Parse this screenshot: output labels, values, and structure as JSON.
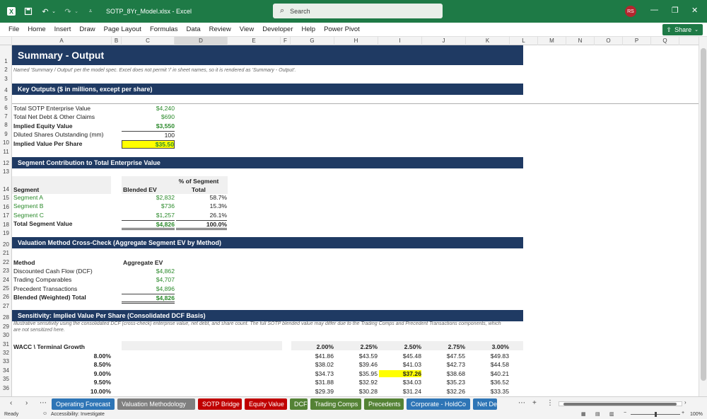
{
  "window": {
    "filename": "SOTP_8Yr_Model.xlsx",
    "app": "Excel",
    "search_placeholder": "Search",
    "user_initials": "RS"
  },
  "menu": [
    "File",
    "Home",
    "Insert",
    "Draw",
    "Page Layout",
    "Formulas",
    "Data",
    "Review",
    "View",
    "Developer",
    "Help",
    "Power Pivot"
  ],
  "share_label": "Share",
  "columns": [
    "A",
    "B",
    "C",
    "D",
    "E",
    "F",
    "G",
    "H",
    "I",
    "J",
    "K",
    "L",
    "M",
    "N",
    "O",
    "P",
    "Q"
  ],
  "rows": [
    "1",
    "2",
    "3",
    "4",
    "5",
    "6",
    "7",
    "8",
    "9",
    "10",
    "11",
    "12",
    "13",
    "14",
    "15",
    "16",
    "17",
    "18",
    "19",
    "20",
    "21",
    "22",
    "23",
    "24",
    "25",
    "26",
    "27",
    "28",
    "29",
    "30",
    "31",
    "32",
    "33",
    "34",
    "35",
    "36"
  ],
  "sheet": {
    "title": "Summary - Output",
    "note_r2": "Named 'Summary / Output' per the model spec. Excel does not permit '/' in sheet names, so it is rendered as 'Summary - Output'.",
    "key_outputs": {
      "header": "Key Outputs ($ in millions, except per share)",
      "rows": [
        {
          "label": "Total SOTP Enterprise Value",
          "value": "$4,240"
        },
        {
          "label": "Total Net Debt & Other Claims",
          "value": "$690"
        },
        {
          "label": "Implied Equity Value",
          "value": "$3,550"
        },
        {
          "label": "Diluted Shares Outstanding (mm)",
          "value": "100"
        },
        {
          "label": "Implied Value Per Share",
          "value": "$35.50"
        }
      ]
    },
    "segments": {
      "header": "Segment Contribution to Total Enterprise Value",
      "col_segment": "Segment",
      "col_ev": "Blended EV",
      "col_pct_line1": "% of Segment",
      "col_pct_line2": "Total",
      "rows": [
        {
          "label": "Segment A",
          "ev": "$2,832",
          "pct": "58.7%"
        },
        {
          "label": "Segment B",
          "ev": "$736",
          "pct": "15.3%"
        },
        {
          "label": "Segment C",
          "ev": "$1,257",
          "pct": "26.1%"
        }
      ],
      "total_label": "Total Segment Value",
      "total_ev": "$4,826",
      "total_pct": "100.0%"
    },
    "crosscheck": {
      "header": "Valuation Method Cross-Check (Aggregate Segment EV by Method)",
      "col_method": "Method",
      "col_ev": "Aggregate EV",
      "rows": [
        {
          "label": "Discounted Cash Flow (DCF)",
          "ev": "$4,862"
        },
        {
          "label": "Trading Comparables",
          "ev": "$4,707"
        },
        {
          "label": "Precedent Transactions",
          "ev": "$4,896"
        }
      ],
      "total_label": "Blended (Weighted) Total",
      "total_ev": "$4,826"
    },
    "sensitivity": {
      "header": "Sensitivity: Implied Value Per Share (Consolidated DCF Basis)",
      "note": "Illustrative sensitivity using the consolidated DCF (cross-check) enterprise value, net debt, and share count. The full SOTP blended value may differ due to the Trading Comps and Precedent Transactions components, which are not sensitized here.",
      "corner_label": "WACC \\ Terminal Growth",
      "growth": [
        "2.00%",
        "2.25%",
        "2.50%",
        "2.75%",
        "3.00%"
      ],
      "rows": [
        {
          "wacc": "8.00%",
          "values": [
            "$41.86",
            "$43.59",
            "$45.48",
            "$47.55",
            "$49.83"
          ]
        },
        {
          "wacc": "8.50%",
          "values": [
            "$38.02",
            "$39.46",
            "$41.03",
            "$42.73",
            "$44.58"
          ]
        },
        {
          "wacc": "9.00%",
          "values": [
            "$34.73",
            "$35.95",
            "$37.26",
            "$38.68",
            "$40.21"
          ]
        },
        {
          "wacc": "9.50%",
          "values": [
            "$31.88",
            "$32.92",
            "$34.03",
            "$35.23",
            "$36.52"
          ]
        },
        {
          "wacc": "10.00%",
          "values": [
            "$29.39",
            "$30.28",
            "$31.24",
            "$32.26",
            "$33.35"
          ]
        }
      ]
    }
  },
  "tabs": [
    {
      "label": "Operating Forecast",
      "color": "#2e75b6"
    },
    {
      "label": "Valuation Methodology",
      "color": "#7f7f7f"
    },
    {
      "label": "SOTP Bridge",
      "color": "#c00000"
    },
    {
      "label": "Equity Value",
      "color": "#c00000"
    },
    {
      "label": "DCF",
      "color": "#548235"
    },
    {
      "label": "Trading Comps",
      "color": "#548235"
    },
    {
      "label": "Precedents",
      "color": "#548235"
    },
    {
      "label": "Corporate - HoldCo",
      "color": "#2e75b6"
    },
    {
      "label": "Net Deb",
      "color": "#2e75b6"
    }
  ],
  "status": {
    "ready": "Ready",
    "accessibility": "Accessibility: Investigate",
    "zoom": "100%"
  }
}
